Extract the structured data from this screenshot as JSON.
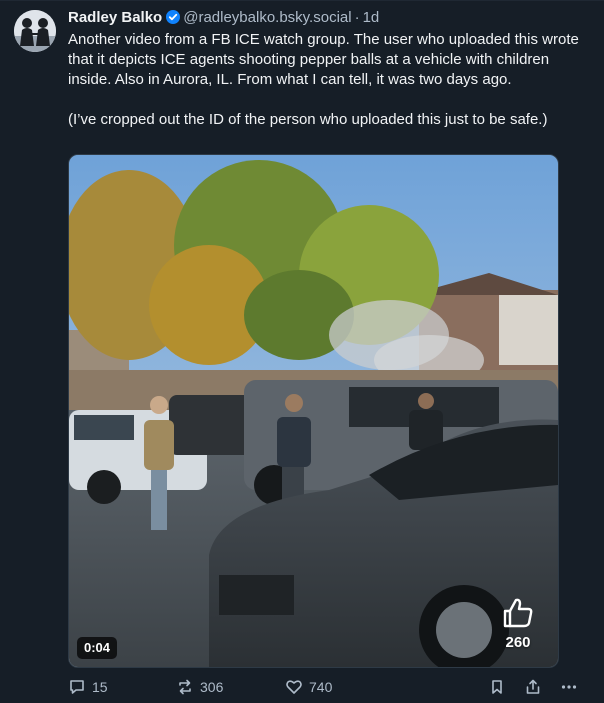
{
  "post": {
    "author_name": "Radley Balko",
    "handle": "@radleybalko.bsky.social",
    "separator": "·",
    "time_ago": "1d",
    "paragraphs": [
      "Another video from a FB ICE watch group. The user who uploaded this wrote that it depicts ICE agents shooting pepper balls at a vehicle with children inside. Also in Aurora, IL. From what I can tell, it was two days ago.",
      "(I’ve cropped out the ID of the person who uploaded this just to be safe.)"
    ]
  },
  "video": {
    "duration": "0:04",
    "overlay_likes": "260"
  },
  "actions": {
    "replies": "15",
    "reposts": "306",
    "likes": "740"
  },
  "colors": {
    "background": "#161e27",
    "text": "#f1f3f5",
    "muted": "#aebbc9",
    "verified": "#1083fe"
  },
  "icons": {
    "verified": "verified-badge-icon",
    "reply": "reply-icon",
    "repost": "repost-icon",
    "like": "heart-icon",
    "bookmark": "bookmark-icon",
    "share": "share-icon",
    "more": "more-options-icon",
    "thumb": "thumbs-up-icon"
  }
}
